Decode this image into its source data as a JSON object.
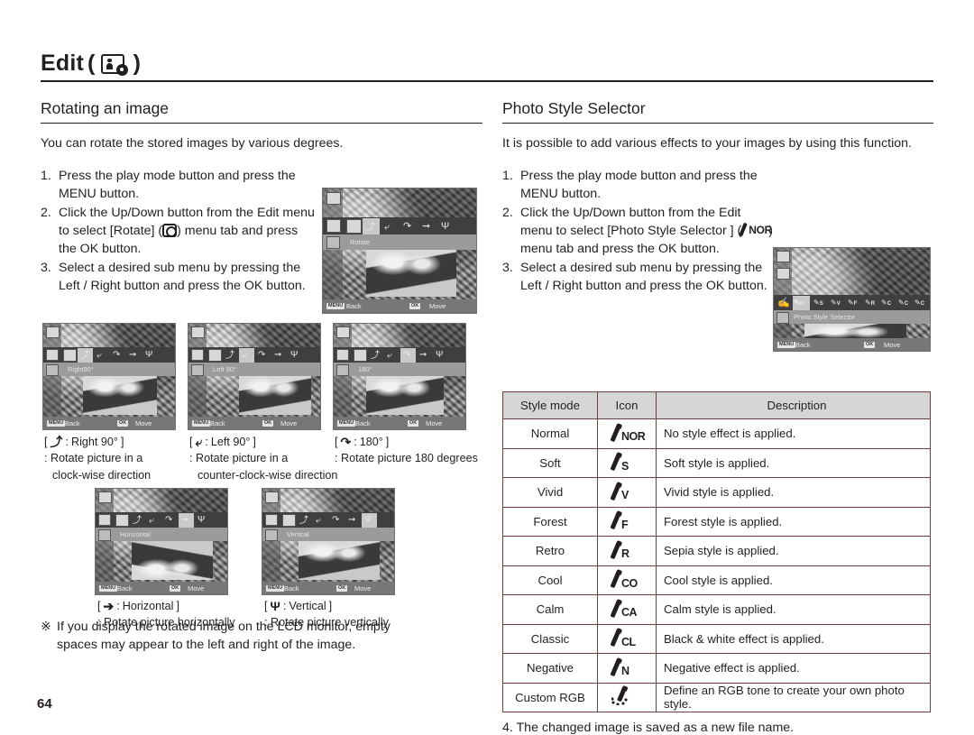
{
  "chapter": {
    "title": "Edit",
    "open_paren": "(",
    "close_paren": ")",
    "icon": "edit-photo-gear-icon"
  },
  "left": {
    "section_title": "Rotating an image",
    "lead": "You can rotate the stored images by various degrees.",
    "steps": [
      {
        "num": "1.",
        "text": "Press the play mode button and press the MENU button."
      },
      {
        "num": "2.",
        "text_before": "Click the Up/Down button from the Edit menu to select [Rotate] (",
        "icon": "rotate-icon",
        "text_after": ") menu tab and press the OK button."
      },
      {
        "num": "3.",
        "text": "Select a desired sub menu by pressing the Left / Right button and press the OK button."
      }
    ],
    "preview_main": {
      "menu_label": "Rotate",
      "back_tag": "MENU",
      "back_label": "Back",
      "move_tag": "OK",
      "move_label": "Move"
    },
    "rotate_options": [
      {
        "lcd_label": "Right90°",
        "glyph": "⤴",
        "title": "Right 90°",
        "desc_line1": ": Rotate picture in a",
        "desc_line2": "clock-wise direction"
      },
      {
        "lcd_label": "Left 90°",
        "glyph": "⤶",
        "title": "Left 90°",
        "desc_line1": ": Rotate picture in a",
        "desc_line2": "counter-clock-wise direction"
      },
      {
        "lcd_label": "180°",
        "glyph": "↷",
        "title": "180°",
        "desc_line1": ": Rotate picture 180 degrees",
        "desc_line2": ""
      }
    ],
    "flip_options": [
      {
        "lcd_label": "Horizontal",
        "glyph": "➔",
        "title": "Horizontal",
        "desc_line1": ": Rotate picture horizontally"
      },
      {
        "lcd_label": "Vertical",
        "glyph": "Ψ",
        "title": "Vertical",
        "desc_line1": ": Rotate picture vertically"
      }
    ],
    "note_mark": "※",
    "note_line1": "If you display the rotated image on the LCD monitor, empty",
    "note_line2": "spaces may appear to the left and right of the image."
  },
  "right": {
    "section_title": "Photo Style Selector",
    "lead": "It is possible to add various effects to your images by using this function.",
    "steps": [
      {
        "num": "1.",
        "text": "Press the play mode button and press the MENU button."
      },
      {
        "num": "2.",
        "text_before": "Click the Up/Down button from the Edit menu to select [Photo Style Selector ] (",
        "icon": "photo-style-nor-icon",
        "icon_label": "NOR",
        "text_after": ") menu tab and press the OK button."
      },
      {
        "num": "3.",
        "text": "Select a desired sub menu by pressing the Left / Right button and press the OK button."
      }
    ],
    "preview_main": {
      "menu_label": "Photo Style Selector",
      "back_tag": "MENU",
      "back_label": "Back",
      "move_tag": "OK",
      "move_label": "Move"
    },
    "table": {
      "headers": [
        "Style mode",
        "Icon",
        "Description"
      ],
      "rows": [
        {
          "mode": "Normal",
          "icon_label": "NOR",
          "icon_name": "style-normal-icon",
          "desc": "No style effect is applied."
        },
        {
          "mode": "Soft",
          "icon_label": "S",
          "icon_name": "style-soft-icon",
          "desc": "Soft style is applied."
        },
        {
          "mode": "Vivid",
          "icon_label": "V",
          "icon_name": "style-vivid-icon",
          "desc": "Vivid style is applied."
        },
        {
          "mode": "Forest",
          "icon_label": "F",
          "icon_name": "style-forest-icon",
          "desc": "Forest style is applied."
        },
        {
          "mode": "Retro",
          "icon_label": "R",
          "icon_name": "style-retro-icon",
          "desc": "Sepia style is applied."
        },
        {
          "mode": "Cool",
          "icon_label": "CO",
          "icon_name": "style-cool-icon",
          "desc": "Cool style is applied."
        },
        {
          "mode": "Calm",
          "icon_label": "CA",
          "icon_name": "style-calm-icon",
          "desc": "Calm style is applied."
        },
        {
          "mode": "Classic",
          "icon_label": "CL",
          "icon_name": "style-classic-icon",
          "desc": "Black & white effect is applied."
        },
        {
          "mode": "Negative",
          "icon_label": "N",
          "icon_name": "style-negative-icon",
          "desc": "Negative effect is applied."
        },
        {
          "mode": "Custom RGB",
          "icon_label": "",
          "icon_name": "style-custom-rgb-icon",
          "desc": "Define an RGB tone to create your own photo style."
        }
      ]
    },
    "tail_step": "4. The changed image is saved as a new file name."
  },
  "page_number": "64"
}
